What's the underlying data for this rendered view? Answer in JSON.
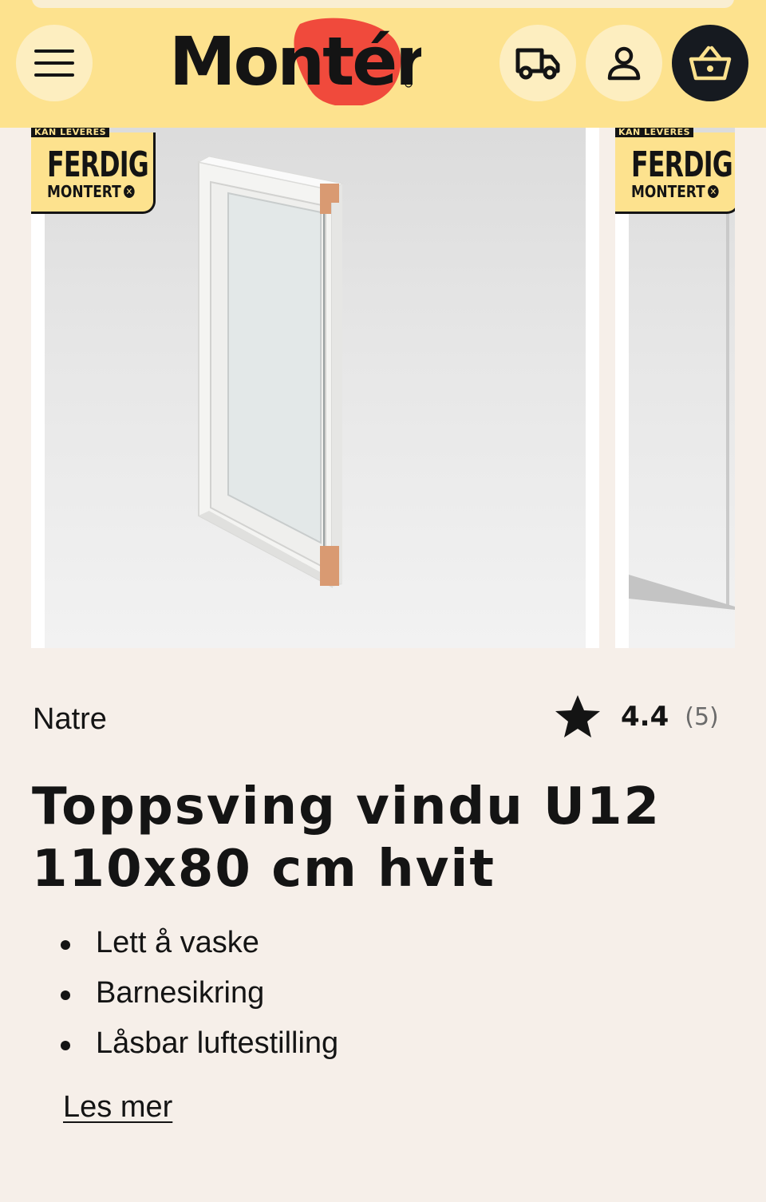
{
  "header": {
    "brand_name": "Montér",
    "brand_accent_color": "#f04a3c",
    "header_bg_color": "#fde28e",
    "buttons": [
      {
        "name": "menu",
        "icon": "hamburger-icon"
      },
      {
        "name": "delivery",
        "icon": "truck-icon"
      },
      {
        "name": "account",
        "icon": "user-icon"
      },
      {
        "name": "cart",
        "icon": "basket-icon"
      }
    ]
  },
  "gallery": {
    "badges": [
      {
        "top": "KAN LEVERES",
        "main": "FERDIG",
        "sub": "MONTERT"
      },
      {
        "top": "KAN LEVERES",
        "main": "FERDIG",
        "sub": "MONTERT"
      }
    ]
  },
  "product": {
    "brand": "Natre",
    "rating": {
      "value": "4.4",
      "count": "(5)",
      "stars": 4.4,
      "icon": "star-icon"
    },
    "title": "Toppsving vindu U12 110x80 cm hvit",
    "features": [
      "Lett å vaske",
      "Barnesikring",
      "Låsbar luftestilling"
    ],
    "read_more": "Les mer"
  }
}
